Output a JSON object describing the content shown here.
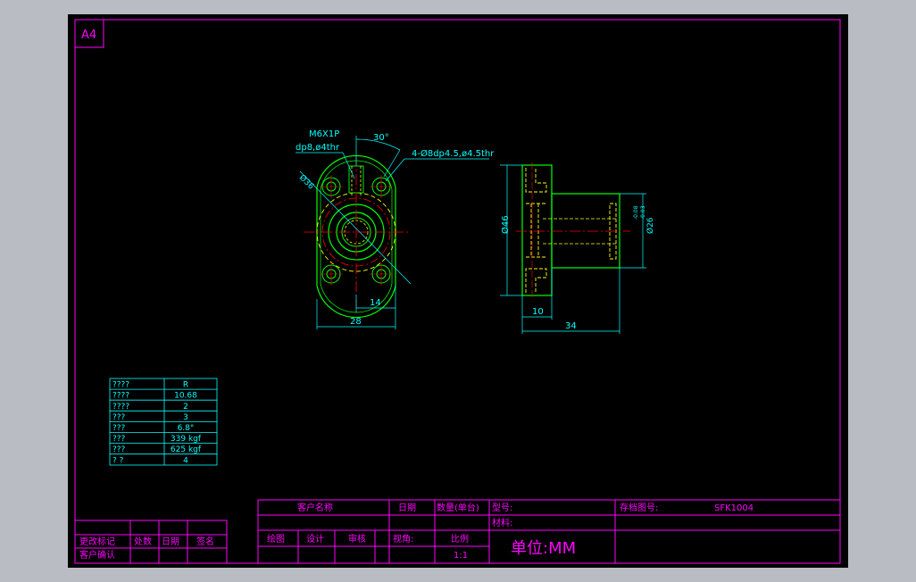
{
  "sheet": {
    "size_label": "A4"
  },
  "front_view": {
    "thread_note_1": "M6X1P",
    "thread_note_2": "dp8,ø4thr",
    "angle_label": "30°",
    "hole_note": "4-Ø8dp4.5,ø4.5thr",
    "pcd_label": "Ø36",
    "dim_width": "28",
    "dim_half": "14"
  },
  "side_view": {
    "dim_flange_dia": "Ø46",
    "dim_body_dia": "Ø26",
    "dim_body_tol_upper": "-0.08",
    "dim_body_tol_lower": "-0.03",
    "dim_flange_thk": "10",
    "dim_length": "34"
  },
  "spec_table": {
    "rows": [
      {
        "label": "????",
        "value": "R"
      },
      {
        "label": "????",
        "value": "10.68"
      },
      {
        "label": "????",
        "value": "2"
      },
      {
        "label": "???",
        "value": "3"
      },
      {
        "label": "???",
        "value": "6.8°"
      },
      {
        "label": "???",
        "value": "339  kgf"
      },
      {
        "label": "???",
        "value": "625  kgf"
      },
      {
        "label": "?    ?",
        "value": "4"
      }
    ]
  },
  "revision_block": {
    "change_mark": "更改标记",
    "place_count": "处数",
    "date": "日期",
    "sign": "签名",
    "customer_confirm": "客户确认"
  },
  "title_block": {
    "customer_name": "客户名称",
    "date": "日期",
    "quantity": "数量(单台)",
    "model_label": "型号:",
    "archive_label": "存档图号:",
    "archive_value": "SFK1004",
    "material_label": "材料:",
    "drawn": "绘图",
    "design": "设计",
    "check": "审核",
    "view_angle": "视角:",
    "scale_label": "比例",
    "scale_value": "1:1",
    "unit": "单位:MM"
  },
  "colors": {
    "background": "#000000",
    "frame": "#ff00ff",
    "outline": "#00ff00",
    "hidden": "#ffff00",
    "center": "#ff0000",
    "dimension": "#00ffff",
    "surround": "#b9bcc3"
  }
}
